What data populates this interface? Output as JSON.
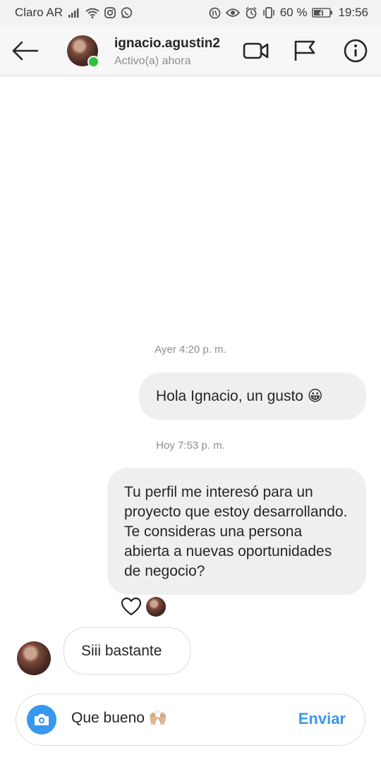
{
  "status_bar": {
    "carrier": "Claro AR",
    "battery": "60 %",
    "time": "19:56"
  },
  "header": {
    "username": "ignacio.agustin2",
    "presence": "Activo(a) ahora",
    "icons": [
      "back-arrow-icon",
      "video-call-icon",
      "flag-icon",
      "info-icon"
    ]
  },
  "conversation": {
    "timestamp_1": "Ayer 4:20 p. m.",
    "message_1": "Hola Ignacio, un gusto 😀",
    "timestamp_2": "Hoy 7:53 p. m.",
    "message_2": "Tu perfil me interesó para un proyecto que estoy desarrollando. Te consideras una persona abierta a nuevas oportunidades de negocio?",
    "reply_1": "Siii bastante"
  },
  "composer": {
    "input_value": "Que bueno 🙌🏼",
    "send_label": "Enviar"
  },
  "colors": {
    "accent": "#3897f0",
    "online": "#2ec23b",
    "bubble_out": "#efefef"
  }
}
